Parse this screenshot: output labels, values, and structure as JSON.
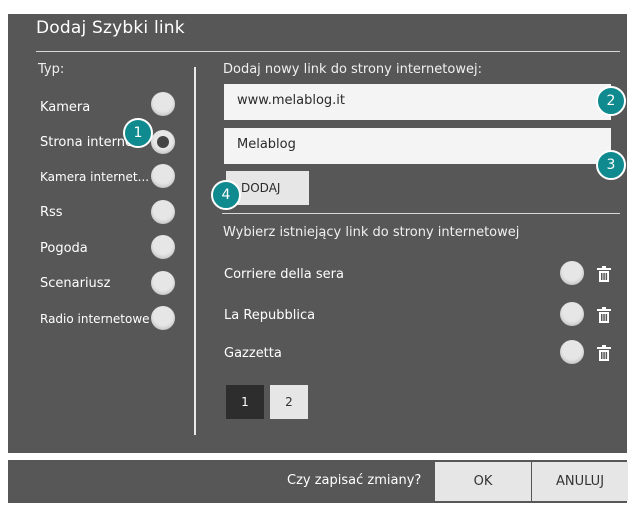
{
  "dialog": {
    "title": "Dodaj Szybki link",
    "type_label": "Typ:",
    "types": [
      {
        "label": "Kamera",
        "selected": false
      },
      {
        "label": "Strona interne",
        "selected": true
      },
      {
        "label": "Kamera internet...",
        "selected": false
      },
      {
        "label": "Rss",
        "selected": false
      },
      {
        "label": "Pogoda",
        "selected": false
      },
      {
        "label": "Scenariusz",
        "selected": false
      },
      {
        "label": "Radio internetowe",
        "selected": false
      }
    ],
    "new_link_label": "Dodaj nowy link do strony internetowej:",
    "url_value": "www.melablog.it",
    "name_value": "Melablog",
    "add_button": "DODAJ",
    "existing_label": "Wybierz istniejący link do strony internetowej",
    "existing_links": [
      "Corriere della sera",
      "La Repubblica",
      "Gazzetta"
    ],
    "pages": [
      "1",
      "2"
    ],
    "current_page": "1"
  },
  "badges": [
    "1",
    "2",
    "3",
    "4"
  ],
  "footer": {
    "question": "Czy zapisać zmiany?",
    "ok": "OK",
    "cancel": "ANULUJ"
  },
  "colors": {
    "panel": "#575757",
    "badge": "#0f8a8f",
    "radio": "#e6e6e6"
  }
}
